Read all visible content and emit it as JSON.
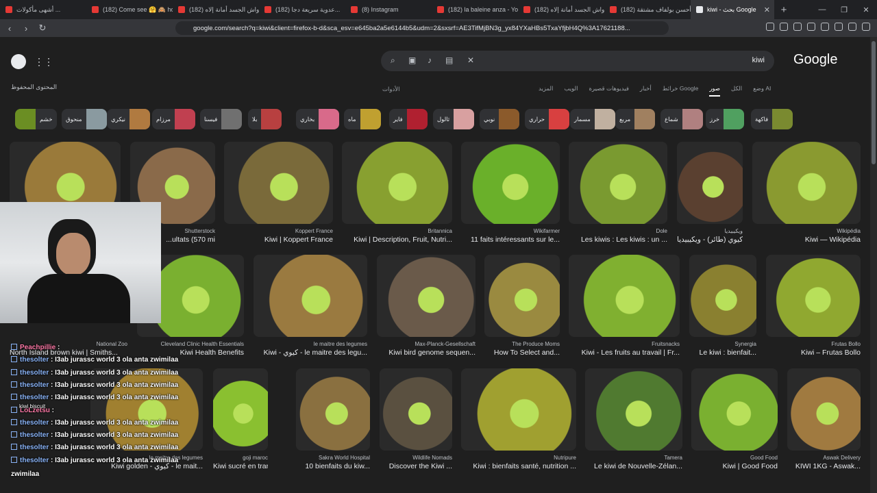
{
  "browser": {
    "tabs": [
      {
        "title": "أشهى مأكولات ...",
        "active": false
      },
      {
        "title": "(182) Come see 🤗 🙈 ho...",
        "active": false
      },
      {
        "title": "(182) واش الجسد أمانة إلاه...",
        "active": false
      },
      {
        "title": "(182) عدوية سريعة دجا...",
        "active": false
      },
      {
        "title": "(8) Instagram",
        "active": false
      },
      {
        "title": "(182) la baleine anza - You...",
        "active": false
      },
      {
        "title": "(182) واش الجسد أمانة إلاه...",
        "active": false
      },
      {
        "title": "(182) أحسن بولفاف مشتقة...",
        "active": false
      },
      {
        "title": "kiwi - بحث Google",
        "active": true
      }
    ],
    "url": "google.com/search?q=kiwi&client=firefox-b-d&sca_esv=e645ba2a5e6144b5&udm=2&sxsrf=AE3TifMjBN3g_yx84YXaHBs5TxaYfjbH4Q%3A17621188...",
    "accent": "#e8eaed"
  },
  "search": {
    "query": "kiwi",
    "brand": "Google",
    "saved_label": "المحتوى المحفوظ",
    "tools_label": "الأدوات",
    "tabs": [
      "وضع AI",
      "الكل",
      "صور",
      "خرائط Google",
      "أخبار",
      "فيديوهات قصيرة",
      "الويب",
      "المزيد"
    ]
  },
  "chips": [
    {
      "label": "خشم",
      "color": "#6b8e23"
    },
    {
      "label": "منحوق",
      "color": "#8a9aa0"
    },
    {
      "label": "نيكري",
      "color": "#b07a40"
    },
    {
      "label": "مرزام",
      "color": "#c04050"
    },
    {
      "label": "فيسنا",
      "color": "#707070"
    },
    {
      "label": "بلا",
      "color": "#b84040"
    },
    {
      "label": "بخاري",
      "color": "#d86a8a"
    },
    {
      "label": "ماه",
      "color": "#c0a030"
    },
    {
      "label": "فاير",
      "color": "#b02030"
    },
    {
      "label": "ثالول",
      "color": "#d8a0a0"
    },
    {
      "label": "نوبي",
      "color": "#8b5a2b"
    },
    {
      "label": "حراري",
      "color": "#d84040"
    },
    {
      "label": "مسمار",
      "color": "#c0b0a0"
    },
    {
      "label": "مربع",
      "color": "#a08060"
    },
    {
      "label": "شماع",
      "color": "#b08080"
    },
    {
      "label": "خرز",
      "color": "#50a060"
    },
    {
      "label": "فاكهة",
      "color": "#7a8a30"
    }
  ],
  "results": {
    "row1": [
      {
        "source": "",
        "title": "",
        "color": "#9a7a3a"
      },
      {
        "source": "Shutterstock",
        "title": "...ultats (570 mi",
        "color": "#8a6a4a"
      },
      {
        "source": "Koppert France",
        "title": "Kiwi | Koppert France",
        "color": "#7a6a3a"
      },
      {
        "source": "Britannica",
        "title": "Kiwi | Description, Fruit, Nutri...",
        "color": "#88a030"
      },
      {
        "source": "Wikifarmer",
        "title": "11 faits intéressants sur le...",
        "color": "#6ab02a"
      },
      {
        "source": "Dole",
        "title": "Les kiwis : Les kiwis : un ...",
        "color": "#7a9a30"
      },
      {
        "source": "ويكيبيديا",
        "title": "كيوي (طائر) - ويكيبيديا",
        "color": "#5a4030"
      },
      {
        "source": "Wikipédia",
        "title": "Kiwi — Wikipédia",
        "color": "#8a9a30"
      }
    ],
    "row2": [
      {
        "source": "Cleveland Clinic Health Essentials",
        "title": "Kiwi Health Benefits",
        "color": "#7ab030"
      },
      {
        "source": "le maitre des legumes",
        "title": "Kiwi - كيوي - le maitre des legu...",
        "color": "#9a7a40"
      },
      {
        "source": "Max-Planck-Gesellschaft",
        "title": "Kiwi bird genome sequen...",
        "color": "#6a5a4a"
      },
      {
        "source": "The Produce Moms",
        "title": "How To Select and...",
        "color": "#9a8a40"
      },
      {
        "source": "Fruitsnacks",
        "title": "Kiwi - Les fruits au travail | Fr...",
        "color": "#80b030"
      },
      {
        "source": "Synergia",
        "title": "Le kiwi : bienfait...",
        "color": "#8a8030"
      },
      {
        "source": "Frutas Bollo",
        "title": "Kiwi – Frutas Bollo",
        "color": "#90a830"
      }
    ],
    "row3": [
      {
        "source": "le maitre des legumes",
        "title": "Kiwi golden - كيوي - le mait...",
        "color": "#a08030"
      },
      {
        "source": "goji maroc",
        "title": "Kiwi sucré en tran...",
        "color": "#8ac030"
      },
      {
        "source": "Sakra World Hospital",
        "title": "10 bienfaits du kiw...",
        "color": "#8a7040"
      },
      {
        "source": "Wildlife Nomads",
        "title": "Discover the Kiwi ...",
        "color": "#5a5040"
      },
      {
        "source": "Nutripure",
        "title": "Kiwi : bienfaits santé, nutrition ...",
        "color": "#a0a030"
      },
      {
        "source": "Tamera",
        "title": "Le kiwi de Nouvelle-Zélan...",
        "color": "#507a30"
      },
      {
        "source": "Good Food",
        "title": "Kiwi | Good Food",
        "color": "#7ab030"
      },
      {
        "source": "Aswak Delivery",
        "title": "KIWI 1KG - Aswak...",
        "color": "#a07a40"
      }
    ],
    "row2_partial_source": "National Zoo",
    "row2_partial_title": "North Island brown kiwi | Smiths..."
  },
  "overlay": {
    "chat": [
      {
        "user": "Peachpillie",
        "text": "",
        "alt": true
      },
      {
        "user": "thesolter",
        "text": "I3ab jurassc world 3 ola anta zwimilaa",
        "alt": false
      },
      {
        "user": "thesolter",
        "text": "I3ab jurassc world 3 ola anta zwimilaa",
        "alt": false
      },
      {
        "user": "thesolter",
        "text": "I3ab jurassc world 3 ola anta zwimilaa",
        "alt": false
      },
      {
        "user": "thesolter",
        "text": "I3ab jurassc world 3 ola anta zwimilaa",
        "alt": false
      },
      {
        "user": "LoLzetsu",
        "text": "",
        "alt": true
      },
      {
        "user": "thesolter",
        "text": "I3ab jurassc world 3 ola anta zwimilaa",
        "alt": false
      },
      {
        "user": "thesolter",
        "text": "I3ab jurassc world 3 ola anta zwimilaa",
        "alt": false
      },
      {
        "user": "thesolter",
        "text": "I3ab jurassc world 3 ola anta zwimilaa",
        "alt": false
      },
      {
        "user": "thesolter",
        "text": "I3ab jurassc world 3 ola anta zwimilaa",
        "alt": false
      }
    ],
    "chat_tail": "zwimilaa",
    "kiwi_biscuit": "kiwi biscuit"
  }
}
